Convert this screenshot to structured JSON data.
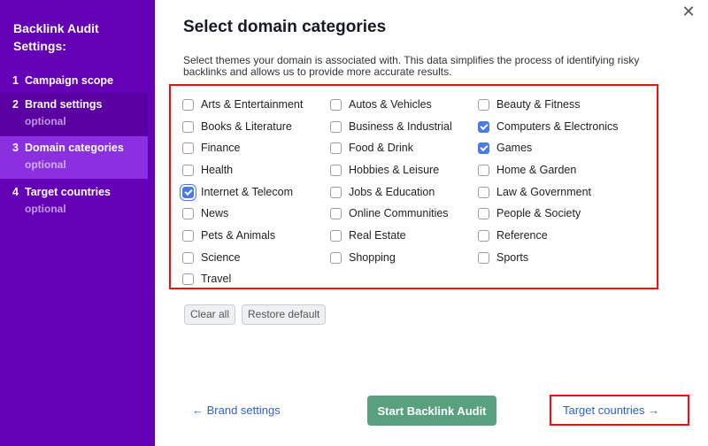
{
  "sidebar": {
    "title": "Backlink Audit Settings:",
    "steps": [
      {
        "num": "1",
        "label": "Campaign scope",
        "sub": ""
      },
      {
        "num": "2",
        "label": "Brand settings",
        "sub": "optional"
      },
      {
        "num": "3",
        "label": "Domain categories",
        "sub": "optional"
      },
      {
        "num": "4",
        "label": "Target countries",
        "sub": "optional"
      }
    ]
  },
  "close_label": "✕",
  "main": {
    "title": "Select domain categories",
    "description": "Select themes your domain is associated with. This data simplifies the process of identifying risky backlinks and allows us to provide more accurate results."
  },
  "categories": [
    {
      "label": "Arts & Entertainment",
      "checked": false
    },
    {
      "label": "Autos & Vehicles",
      "checked": false
    },
    {
      "label": "Beauty & Fitness",
      "checked": false
    },
    {
      "label": "Books & Literature",
      "checked": false
    },
    {
      "label": "Business & Industrial",
      "checked": false
    },
    {
      "label": "Computers & Electronics",
      "checked": true
    },
    {
      "label": "Finance",
      "checked": false
    },
    {
      "label": "Food & Drink",
      "checked": false
    },
    {
      "label": "Games",
      "checked": true
    },
    {
      "label": "Health",
      "checked": false
    },
    {
      "label": "Hobbies & Leisure",
      "checked": false
    },
    {
      "label": "Home & Garden",
      "checked": false
    },
    {
      "label": "Internet & Telecom",
      "checked": true
    },
    {
      "label": "Jobs & Education",
      "checked": false
    },
    {
      "label": "Law & Government",
      "checked": false
    },
    {
      "label": "News",
      "checked": false
    },
    {
      "label": "Online Communities",
      "checked": false
    },
    {
      "label": "People & Society",
      "checked": false
    },
    {
      "label": "Pets & Animals",
      "checked": false
    },
    {
      "label": "Real Estate",
      "checked": false
    },
    {
      "label": "Reference",
      "checked": false
    },
    {
      "label": "Science",
      "checked": false
    },
    {
      "label": "Shopping",
      "checked": false
    },
    {
      "label": "Sports",
      "checked": false
    },
    {
      "label": "Travel",
      "checked": false
    }
  ],
  "buttons": {
    "clear_all": "Clear all",
    "restore_default": "Restore default",
    "back": "← Brand settings",
    "start": "Start Backlink Audit",
    "next": "Target countries →"
  },
  "colors": {
    "sidebar_bg": "#6400b6",
    "active_step_bg": "#8a30e0",
    "primary_button": "#59a07f",
    "link": "#2b5fd9",
    "checkbox_checked": "#4b7be5",
    "highlight_border": "#ff0a0a"
  }
}
